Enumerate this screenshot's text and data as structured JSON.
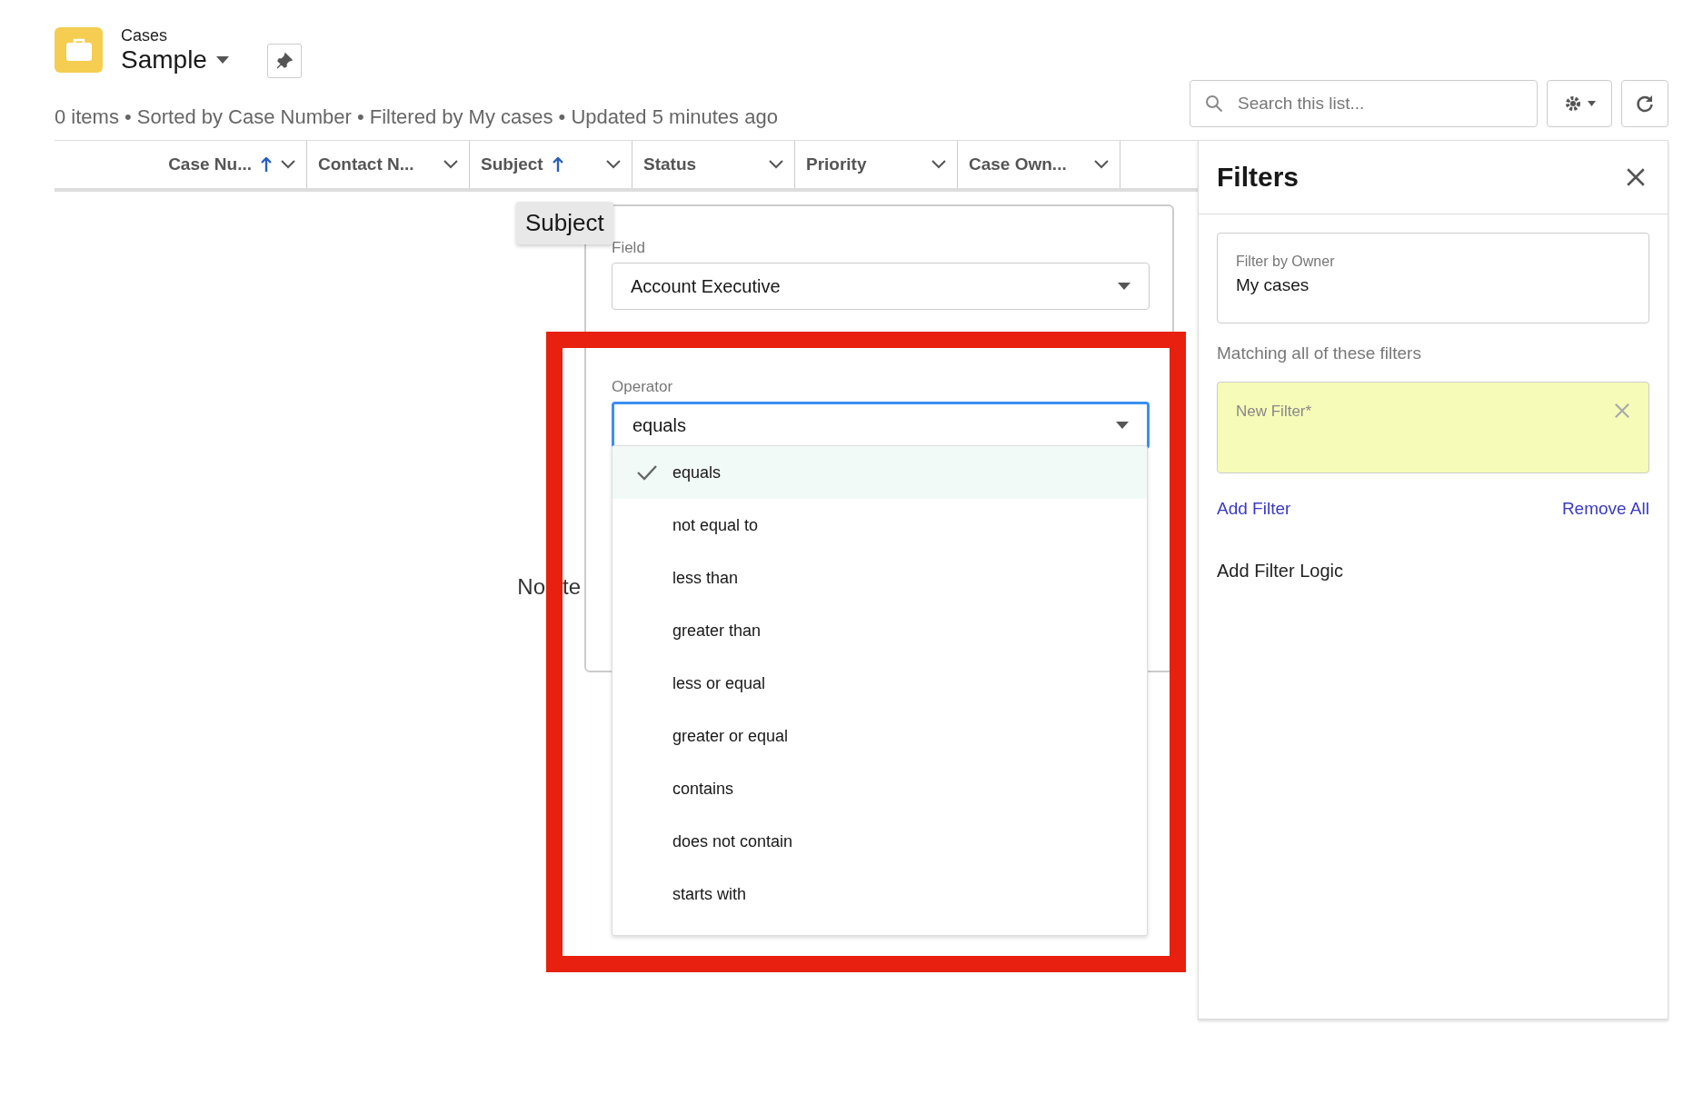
{
  "header": {
    "object": "Cases",
    "title": "Sample",
    "meta": "0 items • Sorted by Case Number • Filtered by My cases • Updated 5 minutes ago"
  },
  "search": {
    "placeholder": "Search this list..."
  },
  "table": {
    "columns": [
      {
        "label": "Case Nu...",
        "sorted": true
      },
      {
        "label": "Contact N...",
        "sorted": false
      },
      {
        "label": "Subject",
        "sorted": true
      },
      {
        "label": "Status",
        "sorted": false
      },
      {
        "label": "Priority",
        "sorted": false
      },
      {
        "label": "Case Own...",
        "sorted": false
      }
    ],
    "empty_text": [
      "No",
      "te"
    ]
  },
  "tooltip": "Subject",
  "filter_editor": {
    "field_label": "Field",
    "field_value": "Account Executive",
    "operator_label": "Operator",
    "operator_value": "equals",
    "options": [
      {
        "label": "equals",
        "selected": true
      },
      {
        "label": "not equal to",
        "selected": false
      },
      {
        "label": "less than",
        "selected": false
      },
      {
        "label": "greater than",
        "selected": false
      },
      {
        "label": "less or equal",
        "selected": false
      },
      {
        "label": "greater or equal",
        "selected": false
      },
      {
        "label": "contains",
        "selected": false
      },
      {
        "label": "does not contain",
        "selected": false
      },
      {
        "label": "starts with",
        "selected": false
      }
    ]
  },
  "filters_panel": {
    "title": "Filters",
    "owner_label": "Filter by Owner",
    "owner_value": "My cases",
    "matching": "Matching all of these filters",
    "filters": [
      {
        "label": "New Filter*",
        "kind": "new"
      }
    ],
    "add": "Add Filter",
    "remove": "Remove All",
    "logic": "Add Filter Logic"
  }
}
